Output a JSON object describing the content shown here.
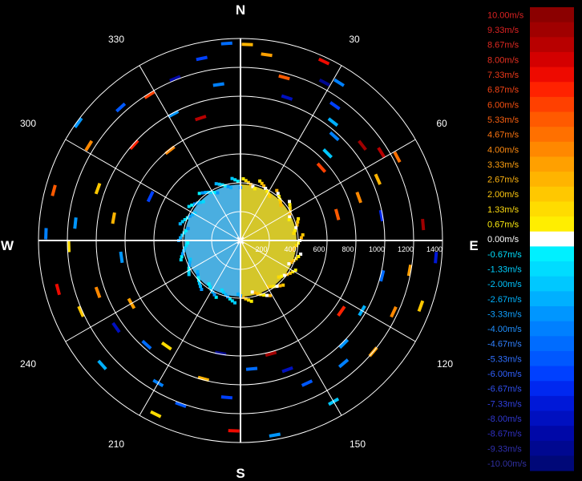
{
  "chart_data": {
    "type": "polar-ppi",
    "cardinals": {
      "N": "N",
      "E": "E",
      "S": "S",
      "W": "W"
    },
    "azimuth_labels": [
      "30",
      "60",
      "120",
      "150",
      "210",
      "240",
      "300",
      "330"
    ],
    "range_labels": [
      "200",
      "400",
      "600",
      "800",
      "1000",
      "1200",
      "1400"
    ],
    "range_max": 1400,
    "legend": [
      {
        "label": "10.00m/s",
        "color": "#8b0000",
        "text_color": "#dd2222"
      },
      {
        "label": "9.33m/s",
        "color": "#a00000",
        "text_color": "#dd2222"
      },
      {
        "label": "8.67m/s",
        "color": "#b80000",
        "text_color": "#e02a22"
      },
      {
        "label": "8.00m/s",
        "color": "#d40000",
        "text_color": "#e83020"
      },
      {
        "label": "7.33m/s",
        "color": "#ee0a00",
        "text_color": "#f03a1a"
      },
      {
        "label": "6.87m/s",
        "color": "#ff2200",
        "text_color": "#f54415"
      },
      {
        "label": "6.00m/s",
        "color": "#ff4000",
        "text_color": "#f85010"
      },
      {
        "label": "5.33m/s",
        "color": "#ff5a00",
        "text_color": "#fa6010"
      },
      {
        "label": "4.67m/s",
        "color": "#ff7000",
        "text_color": "#fc7410"
      },
      {
        "label": "4.00m/s",
        "color": "#ff8800",
        "text_color": "#fe8a10"
      },
      {
        "label": "3.33m/s",
        "color": "#ffa000",
        "text_color": "#ffa010"
      },
      {
        "label": "2.67m/s",
        "color": "#ffb400",
        "text_color": "#ffb410"
      },
      {
        "label": "2.00m/s",
        "color": "#ffc800",
        "text_color": "#ffc810"
      },
      {
        "label": "1.33m/s",
        "color": "#ffdc00",
        "text_color": "#ffdc10"
      },
      {
        "label": "0.67m/s",
        "color": "#ffee00",
        "text_color": "#ffee10"
      },
      {
        "label": "0.00m/s",
        "color": "#ffffff",
        "text_color": "#ffffff"
      },
      {
        "label": "-0.67m/s",
        "color": "#00f0ff",
        "text_color": "#00e0ff"
      },
      {
        "label": "-1.33m/s",
        "color": "#00dcff",
        "text_color": "#00d0ff"
      },
      {
        "label": "-2.00m/s",
        "color": "#00c8ff",
        "text_color": "#00c4ff"
      },
      {
        "label": "-2.67m/s",
        "color": "#00b0ff",
        "text_color": "#00b4ff"
      },
      {
        "label": "-3.33m/s",
        "color": "#0096ff",
        "text_color": "#10a0ff"
      },
      {
        "label": "-4.00m/s",
        "color": "#0080ff",
        "text_color": "#2090ff"
      },
      {
        "label": "-4.67m/s",
        "color": "#006cff",
        "text_color": "#3080ff"
      },
      {
        "label": "-5.33m/s",
        "color": "#0058ff",
        "text_color": "#3070ff"
      },
      {
        "label": "-6.00m/s",
        "color": "#0040ff",
        "text_color": "#3060ff"
      },
      {
        "label": "-6.67m/s",
        "color": "#0028f0",
        "text_color": "#3050f0"
      },
      {
        "label": "-7.33m/s",
        "color": "#0018d8",
        "text_color": "#3040e0"
      },
      {
        "label": "-8.00m/s",
        "color": "#0010c0",
        "text_color": "#3038d0"
      },
      {
        "label": "-8.67m/s",
        "color": "#0008a8",
        "text_color": "#3030c0"
      },
      {
        "label": "-9.33m/s",
        "color": "#000890",
        "text_color": "#3030b0"
      },
      {
        "label": "-10.00m/s",
        "color": "#000878",
        "text_color": "#3030a0"
      }
    ],
    "colors": {
      "background": "#000000",
      "grid": "#ffffff",
      "approaching_core": "#4aaee0",
      "receding_core": "#d4c62a"
    },
    "echoes": [
      {
        "az": 2,
        "r": 1370,
        "v": 2.7
      },
      {
        "az": 8,
        "r": 1310,
        "v": 3.3
      },
      {
        "az": 15,
        "r": 1180,
        "v": 5.3
      },
      {
        "az": 18,
        "r": 1050,
        "v": -8.0
      },
      {
        "az": 25,
        "r": 1380,
        "v": 7.3
      },
      {
        "az": 28,
        "r": 1250,
        "v": -9.3
      },
      {
        "az": 32,
        "r": 1300,
        "v": -4.0
      },
      {
        "az": 35,
        "r": 1150,
        "v": -6.0
      },
      {
        "az": 38,
        "r": 1050,
        "v": -2.7
      },
      {
        "az": 42,
        "r": 980,
        "v": -4.0
      },
      {
        "az": 45,
        "r": 860,
        "v": -2.0
      },
      {
        "az": 48,
        "r": 760,
        "v": 6.0
      },
      {
        "az": 52,
        "r": 1080,
        "v": 9.3
      },
      {
        "az": 58,
        "r": 1160,
        "v": 8.7
      },
      {
        "az": 62,
        "r": 1240,
        "v": 4.7
      },
      {
        "az": 66,
        "r": 1050,
        "v": 2.7
      },
      {
        "az": 70,
        "r": 880,
        "v": 4.0
      },
      {
        "az": 75,
        "r": 700,
        "v": 5.3
      },
      {
        "az": 80,
        "r": 1000,
        "v": -6.7
      },
      {
        "az": 85,
        "r": 1280,
        "v": 9.3
      },
      {
        "az": 95,
        "r": 1370,
        "v": -7.3
      },
      {
        "az": 100,
        "r": 1200,
        "v": 3.3
      },
      {
        "az": 104,
        "r": 1020,
        "v": -4.7
      },
      {
        "az": 110,
        "r": 1340,
        "v": 2.0
      },
      {
        "az": 115,
        "r": 1180,
        "v": 4.0
      },
      {
        "az": 120,
        "r": 980,
        "v": -2.7
      },
      {
        "az": 125,
        "r": 860,
        "v": 6.7
      },
      {
        "az": 130,
        "r": 1210,
        "v": 3.3
      },
      {
        "az": 135,
        "r": 1020,
        "v": -3.3
      },
      {
        "az": 140,
        "r": 1120,
        "v": -4.0
      },
      {
        "az": 150,
        "r": 1300,
        "v": -2.0
      },
      {
        "az": 155,
        "r": 1100,
        "v": -5.3
      },
      {
        "az": 160,
        "r": 960,
        "v": -8.0
      },
      {
        "az": 165,
        "r": 820,
        "v": 9.3
      },
      {
        "az": 170,
        "r": 1380,
        "v": -3.3
      },
      {
        "az": 175,
        "r": 900,
        "v": -4.7
      },
      {
        "az": 182,
        "r": 1330,
        "v": 7.3
      },
      {
        "az": 185,
        "r": 1100,
        "v": -6.0
      },
      {
        "az": 190,
        "r": 800,
        "v": -9.3
      },
      {
        "az": 195,
        "r": 1000,
        "v": 2.7
      },
      {
        "az": 200,
        "r": 1220,
        "v": -5.3
      },
      {
        "az": 206,
        "r": 1350,
        "v": 1.3
      },
      {
        "az": 210,
        "r": 1150,
        "v": -4.0
      },
      {
        "az": 215,
        "r": 900,
        "v": 1.3
      },
      {
        "az": 222,
        "r": 980,
        "v": -4.7
      },
      {
        "az": 228,
        "r": 1300,
        "v": -2.7
      },
      {
        "az": 235,
        "r": 1060,
        "v": -8.0
      },
      {
        "az": 240,
        "r": 880,
        "v": 3.3
      },
      {
        "az": 246,
        "r": 1220,
        "v": 2.0
      },
      {
        "az": 250,
        "r": 1060,
        "v": 4.0
      },
      {
        "az": 255,
        "r": 1320,
        "v": 7.3
      },
      {
        "az": 262,
        "r": 840,
        "v": -3.3
      },
      {
        "az": 268,
        "r": 1200,
        "v": 1.3
      },
      {
        "az": 272,
        "r": 1360,
        "v": -4.0
      },
      {
        "az": 276,
        "r": 1160,
        "v": -3.3
      },
      {
        "az": 280,
        "r": 900,
        "v": 2.7
      },
      {
        "az": 285,
        "r": 1350,
        "v": 5.3
      },
      {
        "az": 290,
        "r": 1060,
        "v": 2.0
      },
      {
        "az": 296,
        "r": 700,
        "v": -6.0
      },
      {
        "az": 302,
        "r": 1250,
        "v": 4.0
      },
      {
        "az": 306,
        "r": 1400,
        "v": -3.3
      },
      {
        "az": 312,
        "r": 1000,
        "v": 6.7
      },
      {
        "az": 318,
        "r": 1250,
        "v": -5.3
      },
      {
        "az": 322,
        "r": 800,
        "v": 4.0
      },
      {
        "az": 328,
        "r": 1200,
        "v": 6.0
      },
      {
        "az": 332,
        "r": 1000,
        "v": -3.3
      },
      {
        "az": 338,
        "r": 1220,
        "v": -8.7
      },
      {
        "az": 342,
        "r": 900,
        "v": 8.7
      },
      {
        "az": 348,
        "r": 1300,
        "v": -6.0
      },
      {
        "az": 352,
        "r": 1100,
        "v": -4.0
      },
      {
        "az": 356,
        "r": 1380,
        "v": -4.7
      }
    ]
  }
}
